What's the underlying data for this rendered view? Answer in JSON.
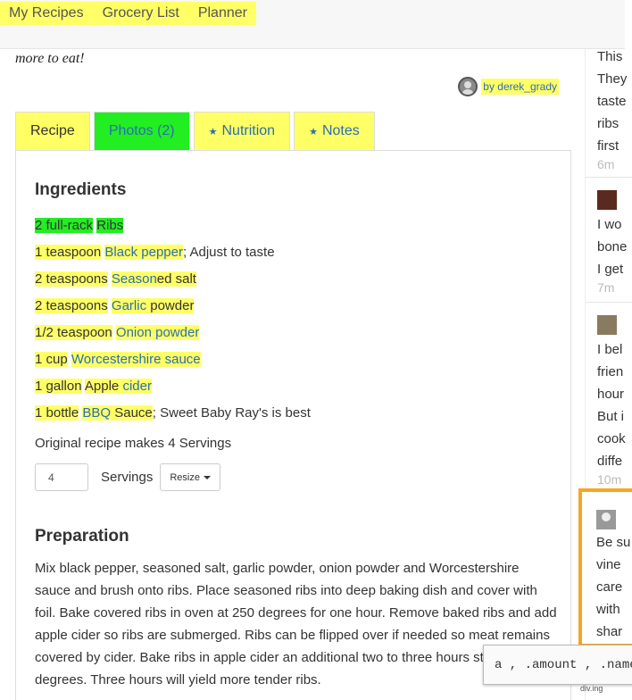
{
  "nav": {
    "items": [
      "My Recipes",
      "Grocery List",
      "Planner"
    ]
  },
  "recipe": {
    "tagline": "more to eat!",
    "author": "by derek_grady",
    "tabs": [
      {
        "label": "Recipe"
      },
      {
        "label": "Photos (2)"
      },
      {
        "label": "Nutrition"
      },
      {
        "label": "Notes"
      }
    ],
    "ingredients_heading": "Ingredients",
    "ingredients": [
      {
        "amount": "2 full-rack",
        "name": "Ribs"
      },
      {
        "amount": "1 teaspoon",
        "name": "Black pepper",
        "note": "; Adjust to taste"
      },
      {
        "amount": "2 teaspoons",
        "name": "Season",
        "name_rest": "ed salt"
      },
      {
        "amount": "2 teaspoons",
        "name": "Garlic",
        "name_rest": " powder"
      },
      {
        "amount": "1/2 teaspoon",
        "name": "Onion powder"
      },
      {
        "amount": "1 cup",
        "name": "Worcestershire sauce"
      },
      {
        "amount": "1 gallon",
        "name_pre": "Apple ",
        "name": "cider"
      },
      {
        "amount": "1 bottle",
        "name": "BBQ",
        "name_rest": " Sauce",
        "note": "; Sweet Baby Ray's is best"
      }
    ],
    "makes": "Original recipe makes 4 Servings",
    "servings_value": "4",
    "servings_label": "Servings",
    "resize_label": "Resize",
    "preparation_heading": "Preparation",
    "preparation": "Mix black pepper, seasoned salt, garlic powder, onion powder and Worcestershire sauce and brush onto ribs. Place seasoned ribs into deep baking dish and cover with foil. Bake covered ribs in oven at 250 degrees for one hour. Remove baked ribs and add apple cider so ribs are submerged. Ribs can be flipped over if needed so meat remains covered by cider. Bake ribs in apple cider an additional two to three hours still at 250 degrees. Three hours will yield more tender ribs."
  },
  "comments": [
    {
      "lines": [
        "This",
        "They",
        "taste",
        "ribs",
        "first"
      ],
      "time": "6m"
    },
    {
      "lines": [
        "I wo",
        "bone",
        "I get"
      ],
      "time": "7m"
    },
    {
      "lines": [
        "I bel",
        "frien",
        "hour",
        "But i",
        "cook",
        "diffe"
      ],
      "time": "10m"
    },
    {
      "lines": [
        "Be su",
        "vine",
        "care",
        "with",
        "shar"
      ],
      "time": ""
    }
  ],
  "tooltip": {
    "text": "a , .amount , .name",
    "footer": "div.ing"
  },
  "colors": {
    "highlight_yellow": "#ffff66",
    "highlight_green": "#22ee22",
    "link": "#2a6fb0",
    "focus_orange": "#f5a623"
  }
}
